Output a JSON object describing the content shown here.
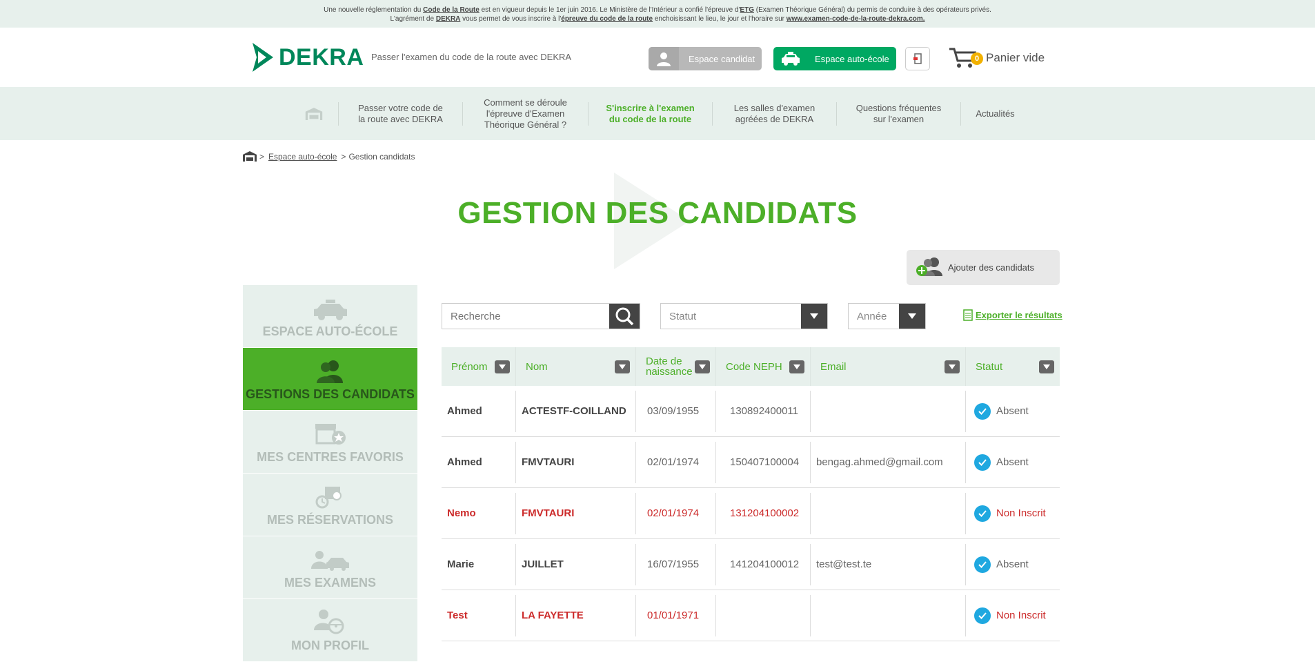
{
  "announcement": {
    "line1_a": "Une nouvelle réglementation du ",
    "line1_link1": "Code de la Route",
    "line1_b": " est en vigueur depuis le 1er juin 2016. Le Ministère de l'Intérieur a confié l'épreuve d'",
    "line1_link2": "ETG",
    "line1_c": " (Examen Théorique Général)  du permis de conduire à des opérateurs privés.",
    "line2_a": "L'agrément de ",
    "line2_link1": "DEKRA",
    "line2_b": " vous permet de vous inscrire à l'",
    "line2_link2": "épreuve du code de la route",
    "line2_c": " enchoisissant le lieu, le jour et l'horaire sur ",
    "line2_link3": "www.examen-code-de-la-route-dekra.com."
  },
  "header": {
    "logo_text": "DEKRA",
    "tagline": "Passer l'examen du code de la route avec DEKRA",
    "candidate_space": "Espace candidat",
    "driving_school_space": "Espace auto-école",
    "cart_count": "0",
    "cart_label": "Panier vide"
  },
  "nav": {
    "items": [
      {
        "label": "Passer votre code de la route avec DEKRA"
      },
      {
        "label": "Comment se déroule l'épreuve d'Examen Théorique Général ?"
      },
      {
        "label": "S'inscrire à l'examen du code de la route"
      },
      {
        "label": "Les salles d'examen agréées de DEKRA"
      },
      {
        "label": "Questions fréquentes sur l'examen"
      },
      {
        "label": "Actualités"
      }
    ]
  },
  "breadcrumb": {
    "sep": ">",
    "link": "Espace auto-école",
    "current": "Gestion candidats"
  },
  "page_title": "GESTION DES CANDIDATS",
  "add_button": "Ajouter des candidats",
  "sidebar": {
    "items": [
      {
        "label": "ESPACE AUTO-ÉCOLE",
        "icon": "car-icon"
      },
      {
        "label": "GESTIONS DES CANDIDATS",
        "icon": "users-icon"
      },
      {
        "label": "MES CENTRES FAVORIS",
        "icon": "store-star-icon"
      },
      {
        "label": "MES RÉSERVATIONS",
        "icon": "calendar-clock-icon"
      },
      {
        "label": "MES EXAMENS",
        "icon": "person-car-icon"
      },
      {
        "label": "MON PROFIL",
        "icon": "person-wheel-icon"
      }
    ]
  },
  "filters": {
    "search_placeholder": "Recherche",
    "status_placeholder": "Statut",
    "year_placeholder": "Année",
    "export_label": "Exporter le résultats"
  },
  "table": {
    "headers": [
      "Prénom",
      "Nom",
      "Date de naissance",
      "Code NEPH",
      "Email",
      "Statut"
    ],
    "rows": [
      {
        "prenom": "Ahmed",
        "nom": "ACTESTF-COILLAND",
        "naissance": "03/09/1955",
        "neph": "130892400011",
        "email": "",
        "statut": "Absent",
        "highlight": false
      },
      {
        "prenom": "Ahmed",
        "nom": "FMVTAURI",
        "naissance": "02/01/1974",
        "neph": "150407100004",
        "email": "bengag.ahmed@gmail.com",
        "statut": "Absent",
        "highlight": false
      },
      {
        "prenom": "Nemo",
        "nom": "FMVTAURI",
        "naissance": "02/01/1974",
        "neph": "131204100002",
        "email": "",
        "statut": "Non Inscrit",
        "highlight": true
      },
      {
        "prenom": "Marie",
        "nom": "JUILLET",
        "naissance": "16/07/1955",
        "neph": "141204100012",
        "email": "test@test.te",
        "statut": "Absent",
        "highlight": false
      },
      {
        "prenom": "Test",
        "nom": "LA FAYETTE",
        "naissance": "01/01/1971",
        "neph": "",
        "email": "",
        "statut": "Non Inscrit",
        "highlight": true
      }
    ]
  },
  "colors": {
    "brand_green": "#4caf28",
    "dekra_green": "#00875a",
    "accent_blue": "#1fa8e0",
    "alert_red": "#cc2b2b"
  }
}
